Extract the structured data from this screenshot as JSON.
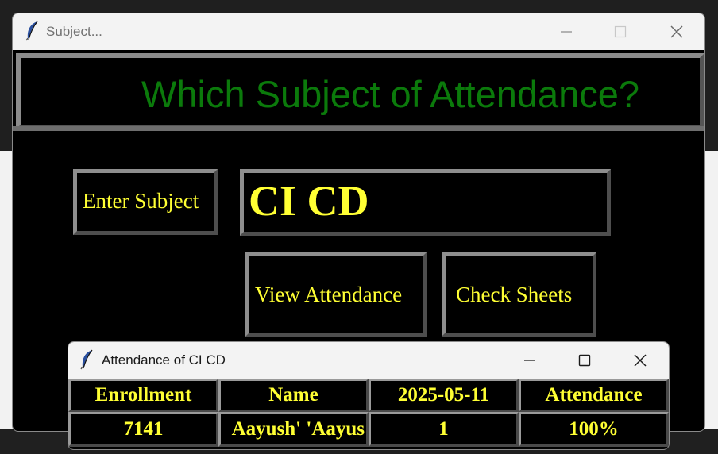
{
  "main_window": {
    "title": "Subject...",
    "heading": "Which Subject of Attendance?",
    "enter_subject_label": "Enter Subject",
    "subject_value": "CI CD",
    "view_attendance_label": "View Attendance",
    "check_sheets_label": "Check Sheets"
  },
  "attendance_window": {
    "title": "Attendance of CI CD",
    "columns": [
      "Enrollment",
      "Name",
      "2025-05-11",
      "Attendance"
    ],
    "rows": [
      [
        "7141",
        "Aayush' 'Aayus",
        "1",
        "100%"
      ]
    ]
  },
  "colors": {
    "heading": "#0b7a0b",
    "label_text": "#ffff33",
    "panel_bg": "#000000",
    "bevel": "#7a7a7a"
  },
  "icons": {
    "app_icon": "feather-icon",
    "minimize": "minimize-icon",
    "maximize": "maximize-icon",
    "close": "close-icon"
  }
}
